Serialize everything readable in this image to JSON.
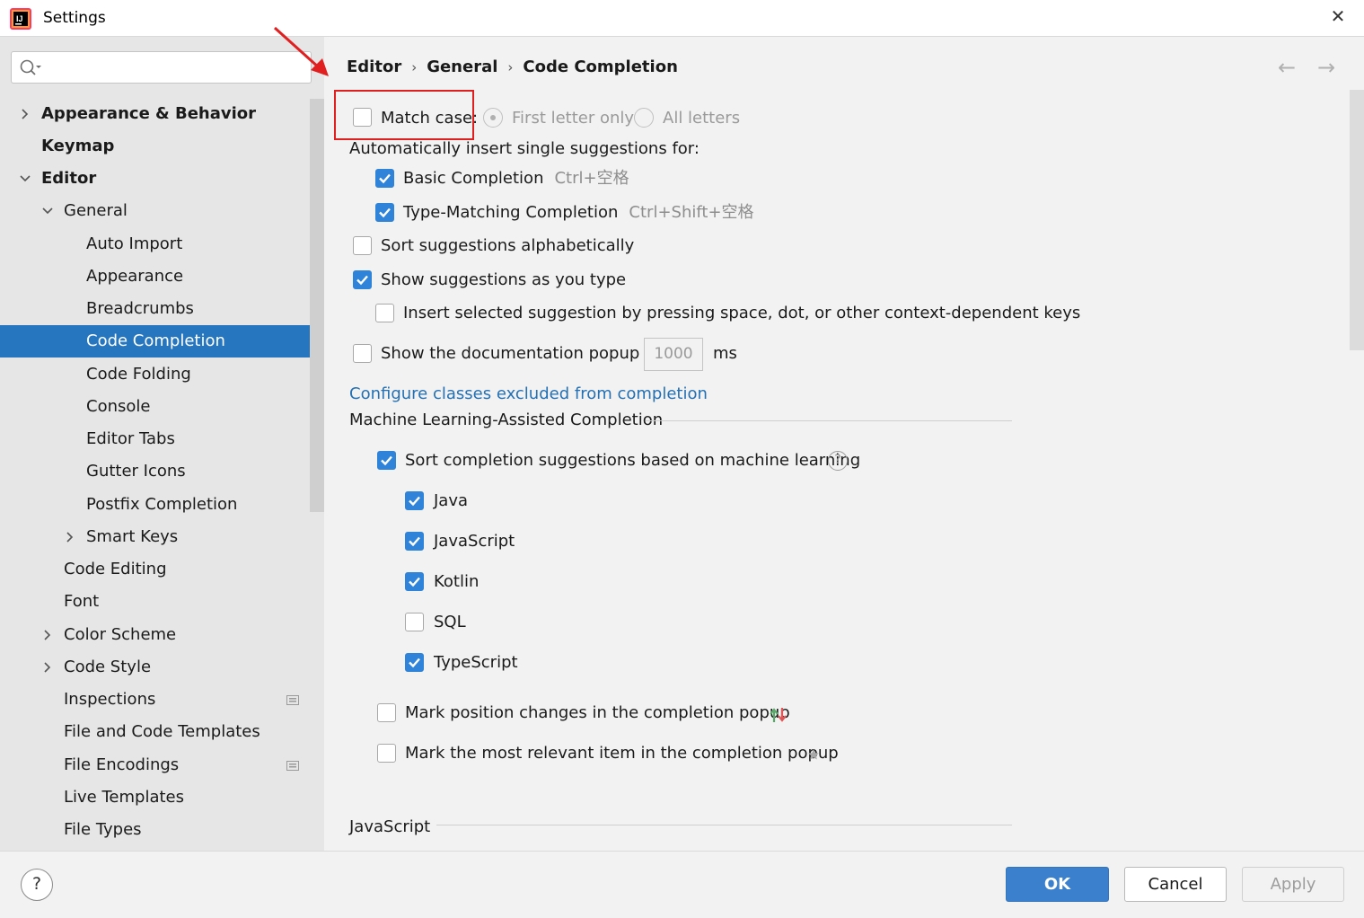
{
  "window": {
    "title": "Settings",
    "close": "✕"
  },
  "search": {
    "placeholder": ""
  },
  "tree": [
    {
      "label": "Appearance & Behavior",
      "bold": true,
      "chevron": "right",
      "selected": false,
      "project_icon": false
    },
    {
      "label": "Keymap",
      "bold": true,
      "chevron": "",
      "selected": false,
      "project_icon": false
    },
    {
      "label": "Editor",
      "bold": true,
      "chevron": "down",
      "selected": false,
      "project_icon": false
    },
    {
      "label": "General",
      "bold": false,
      "chevron": "down",
      "selected": false,
      "project_icon": false
    },
    {
      "label": "Auto Import",
      "bold": false,
      "chevron": "",
      "selected": false,
      "project_icon": false
    },
    {
      "label": "Appearance",
      "bold": false,
      "chevron": "",
      "selected": false,
      "project_icon": false
    },
    {
      "label": "Breadcrumbs",
      "bold": false,
      "chevron": "",
      "selected": false,
      "project_icon": false
    },
    {
      "label": "Code Completion",
      "bold": false,
      "chevron": "",
      "selected": true,
      "project_icon": false
    },
    {
      "label": "Code Folding",
      "bold": false,
      "chevron": "",
      "selected": false,
      "project_icon": false
    },
    {
      "label": "Console",
      "bold": false,
      "chevron": "",
      "selected": false,
      "project_icon": false
    },
    {
      "label": "Editor Tabs",
      "bold": false,
      "chevron": "",
      "selected": false,
      "project_icon": false
    },
    {
      "label": "Gutter Icons",
      "bold": false,
      "chevron": "",
      "selected": false,
      "project_icon": false
    },
    {
      "label": "Postfix Completion",
      "bold": false,
      "chevron": "",
      "selected": false,
      "project_icon": false
    },
    {
      "label": "Smart Keys",
      "bold": false,
      "chevron": "right",
      "selected": false,
      "project_icon": false
    },
    {
      "label": "Code Editing",
      "bold": false,
      "chevron": "",
      "selected": false,
      "project_icon": false
    },
    {
      "label": "Font",
      "bold": false,
      "chevron": "",
      "selected": false,
      "project_icon": false
    },
    {
      "label": "Color Scheme",
      "bold": false,
      "chevron": "right",
      "selected": false,
      "project_icon": false
    },
    {
      "label": "Code Style",
      "bold": false,
      "chevron": "right",
      "selected": false,
      "project_icon": false
    },
    {
      "label": "Inspections",
      "bold": false,
      "chevron": "",
      "selected": false,
      "project_icon": true
    },
    {
      "label": "File and Code Templates",
      "bold": false,
      "chevron": "",
      "selected": false,
      "project_icon": false
    },
    {
      "label": "File Encodings",
      "bold": false,
      "chevron": "",
      "selected": false,
      "project_icon": true
    },
    {
      "label": "Live Templates",
      "bold": false,
      "chevron": "",
      "selected": false,
      "project_icon": false
    },
    {
      "label": "File Types",
      "bold": false,
      "chevron": "",
      "selected": false,
      "project_icon": false
    }
  ],
  "breadcrumb": [
    "Editor",
    "General",
    "Code Completion"
  ],
  "nav": {
    "back": "←",
    "forward": "→"
  },
  "match_case": {
    "label": "Match case:",
    "checked": false,
    "options": [
      {
        "label": "First letter only",
        "selected": true,
        "enabled": false
      },
      {
        "label": "All letters",
        "selected": false,
        "enabled": false
      }
    ]
  },
  "auto_insert_title": "Automatically insert single suggestions for:",
  "auto_insert": [
    {
      "label": "Basic Completion",
      "shortcut": "Ctrl+空格",
      "checked": true
    },
    {
      "label": "Type-Matching Completion",
      "shortcut": "Ctrl+Shift+空格",
      "checked": true
    }
  ],
  "sort_alpha": {
    "label": "Sort suggestions alphabetically",
    "checked": false
  },
  "show_as_type": {
    "label": "Show suggestions as you type",
    "checked": true
  },
  "insert_selected": {
    "label": "Insert selected suggestion by pressing space, dot, or other context-dependent keys",
    "checked": false
  },
  "doc_popup": {
    "label": "Show the documentation popup in",
    "value": "1000",
    "unit": "ms",
    "checked": false
  },
  "configure_link": "Configure classes excluded from completion",
  "ml_section": {
    "title": "Machine Learning-Assisted Completion",
    "sort_ml": {
      "label": "Sort completion suggestions based on machine learning",
      "checked": true,
      "help": "?"
    },
    "languages": [
      {
        "label": "Java",
        "checked": true
      },
      {
        "label": "JavaScript",
        "checked": true
      },
      {
        "label": "Kotlin",
        "checked": true
      },
      {
        "label": "SQL",
        "checked": false
      },
      {
        "label": "TypeScript",
        "checked": true
      }
    ],
    "mark_changes": {
      "label": "Mark position changes in the completion popup",
      "checked": false,
      "icon": "position-change-arrows-icon"
    },
    "mark_relevant": {
      "label": "Mark the most relevant item in the completion popup",
      "checked": false,
      "icon": "star-icon"
    }
  },
  "js_section": {
    "title": "JavaScript"
  },
  "footer": {
    "help": "?",
    "ok": "OK",
    "cancel": "Cancel",
    "apply": "Apply"
  },
  "colors": {
    "selection": "#2675bf",
    "checkbox": "#2f83d8",
    "link": "#2470b3",
    "annotation_red": "#e02020",
    "ok_button": "#3a80cc"
  }
}
